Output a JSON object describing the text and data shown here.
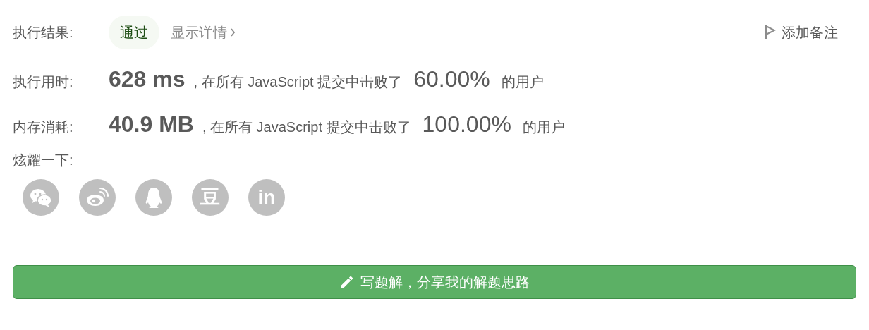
{
  "result": {
    "label": "执行结果:",
    "status": "通过",
    "details_link": "显示详情",
    "add_note": "添加备注"
  },
  "stats": [
    {
      "label": "执行用时:",
      "value": "628 ms",
      "prefix": ", 在所有 JavaScript 提交中击败了",
      "percent": "60.00%",
      "suffix": "的用户"
    },
    {
      "label": "内存消耗:",
      "value": "40.9 MB",
      "prefix": ", 在所有 JavaScript 提交中击败了",
      "percent": "100.00%",
      "suffix": "的用户"
    }
  ],
  "share": {
    "label": "炫耀一下:",
    "buttons": [
      {
        "kind": "wechat"
      },
      {
        "kind": "weibo"
      },
      {
        "kind": "qq"
      },
      {
        "kind": "text",
        "text": "豆"
      },
      {
        "kind": "text",
        "text": "in"
      }
    ]
  },
  "write_button": "写题解，分享我的解题思路"
}
